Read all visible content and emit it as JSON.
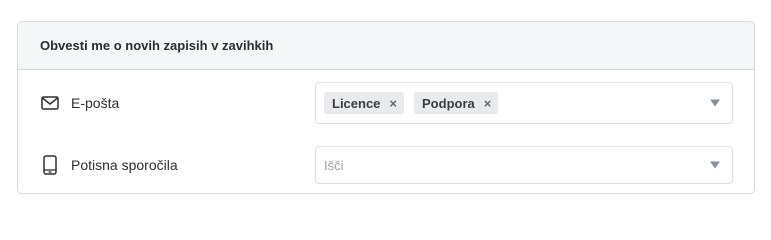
{
  "header": {
    "title": "Obvesti me o novih zapisih v zavihkih"
  },
  "email": {
    "label": "E-pošta",
    "icon": "envelope-icon",
    "chips": [
      {
        "label": "Licence",
        "remove": "×"
      },
      {
        "label": "Podpora",
        "remove": "×"
      }
    ]
  },
  "push": {
    "label": "Potisna sporočila",
    "icon": "mobile-phone-icon",
    "placeholder": "Išči"
  }
}
